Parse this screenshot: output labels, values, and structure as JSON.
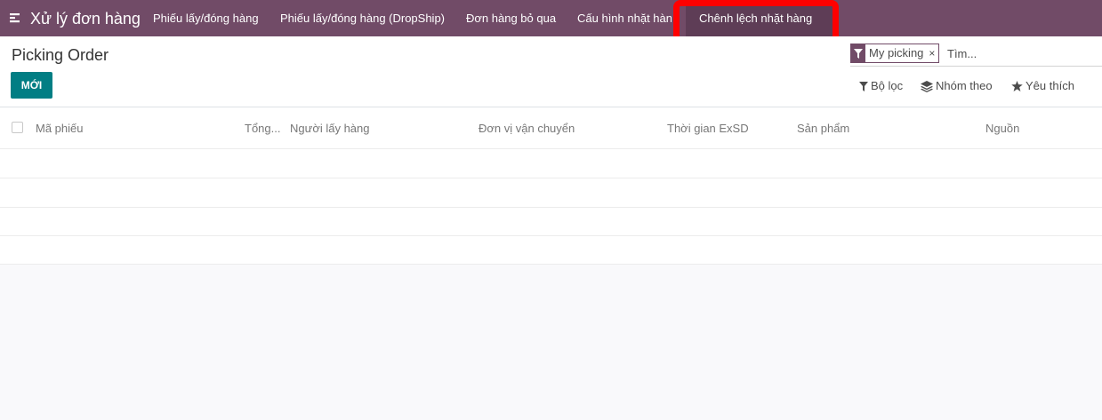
{
  "navbar": {
    "app_title": "Xử lý đơn hàng",
    "menu": [
      {
        "label": "Phiếu lấy/đóng hàng"
      },
      {
        "label": "Phiếu lấy/đóng hàng (DropShip)"
      },
      {
        "label": "Đơn hàng bỏ qua"
      },
      {
        "label": "Cấu hình nhặt hàng"
      },
      {
        "label": "Chênh lệch nhặt hàng"
      }
    ],
    "active_item": "Chênh lệch nhặt hàng",
    "highlight_color": "#ff0000",
    "bar_color": "#714b67",
    "icon": "menu-toggle-icon"
  },
  "control_panel": {
    "page_title": "Picking Order",
    "new_button_label": "MỚI",
    "new_button_color": "#017e84"
  },
  "search": {
    "facet": {
      "label": "My picking",
      "icon": "filter-icon",
      "remove_glyph": "×"
    },
    "placeholder": "Tìm..."
  },
  "filters": {
    "filter_label": "Bộ lọc",
    "group_by_label": "Nhóm theo",
    "favorites_label": "Yêu thích"
  },
  "table": {
    "columns": [
      "Mã phiếu",
      "Tổng...",
      "Người lấy hàng",
      "Đơn vị vận chuyển",
      "Thời gian ExSD",
      "Sản phẩm",
      "Nguồn"
    ],
    "rows": []
  }
}
